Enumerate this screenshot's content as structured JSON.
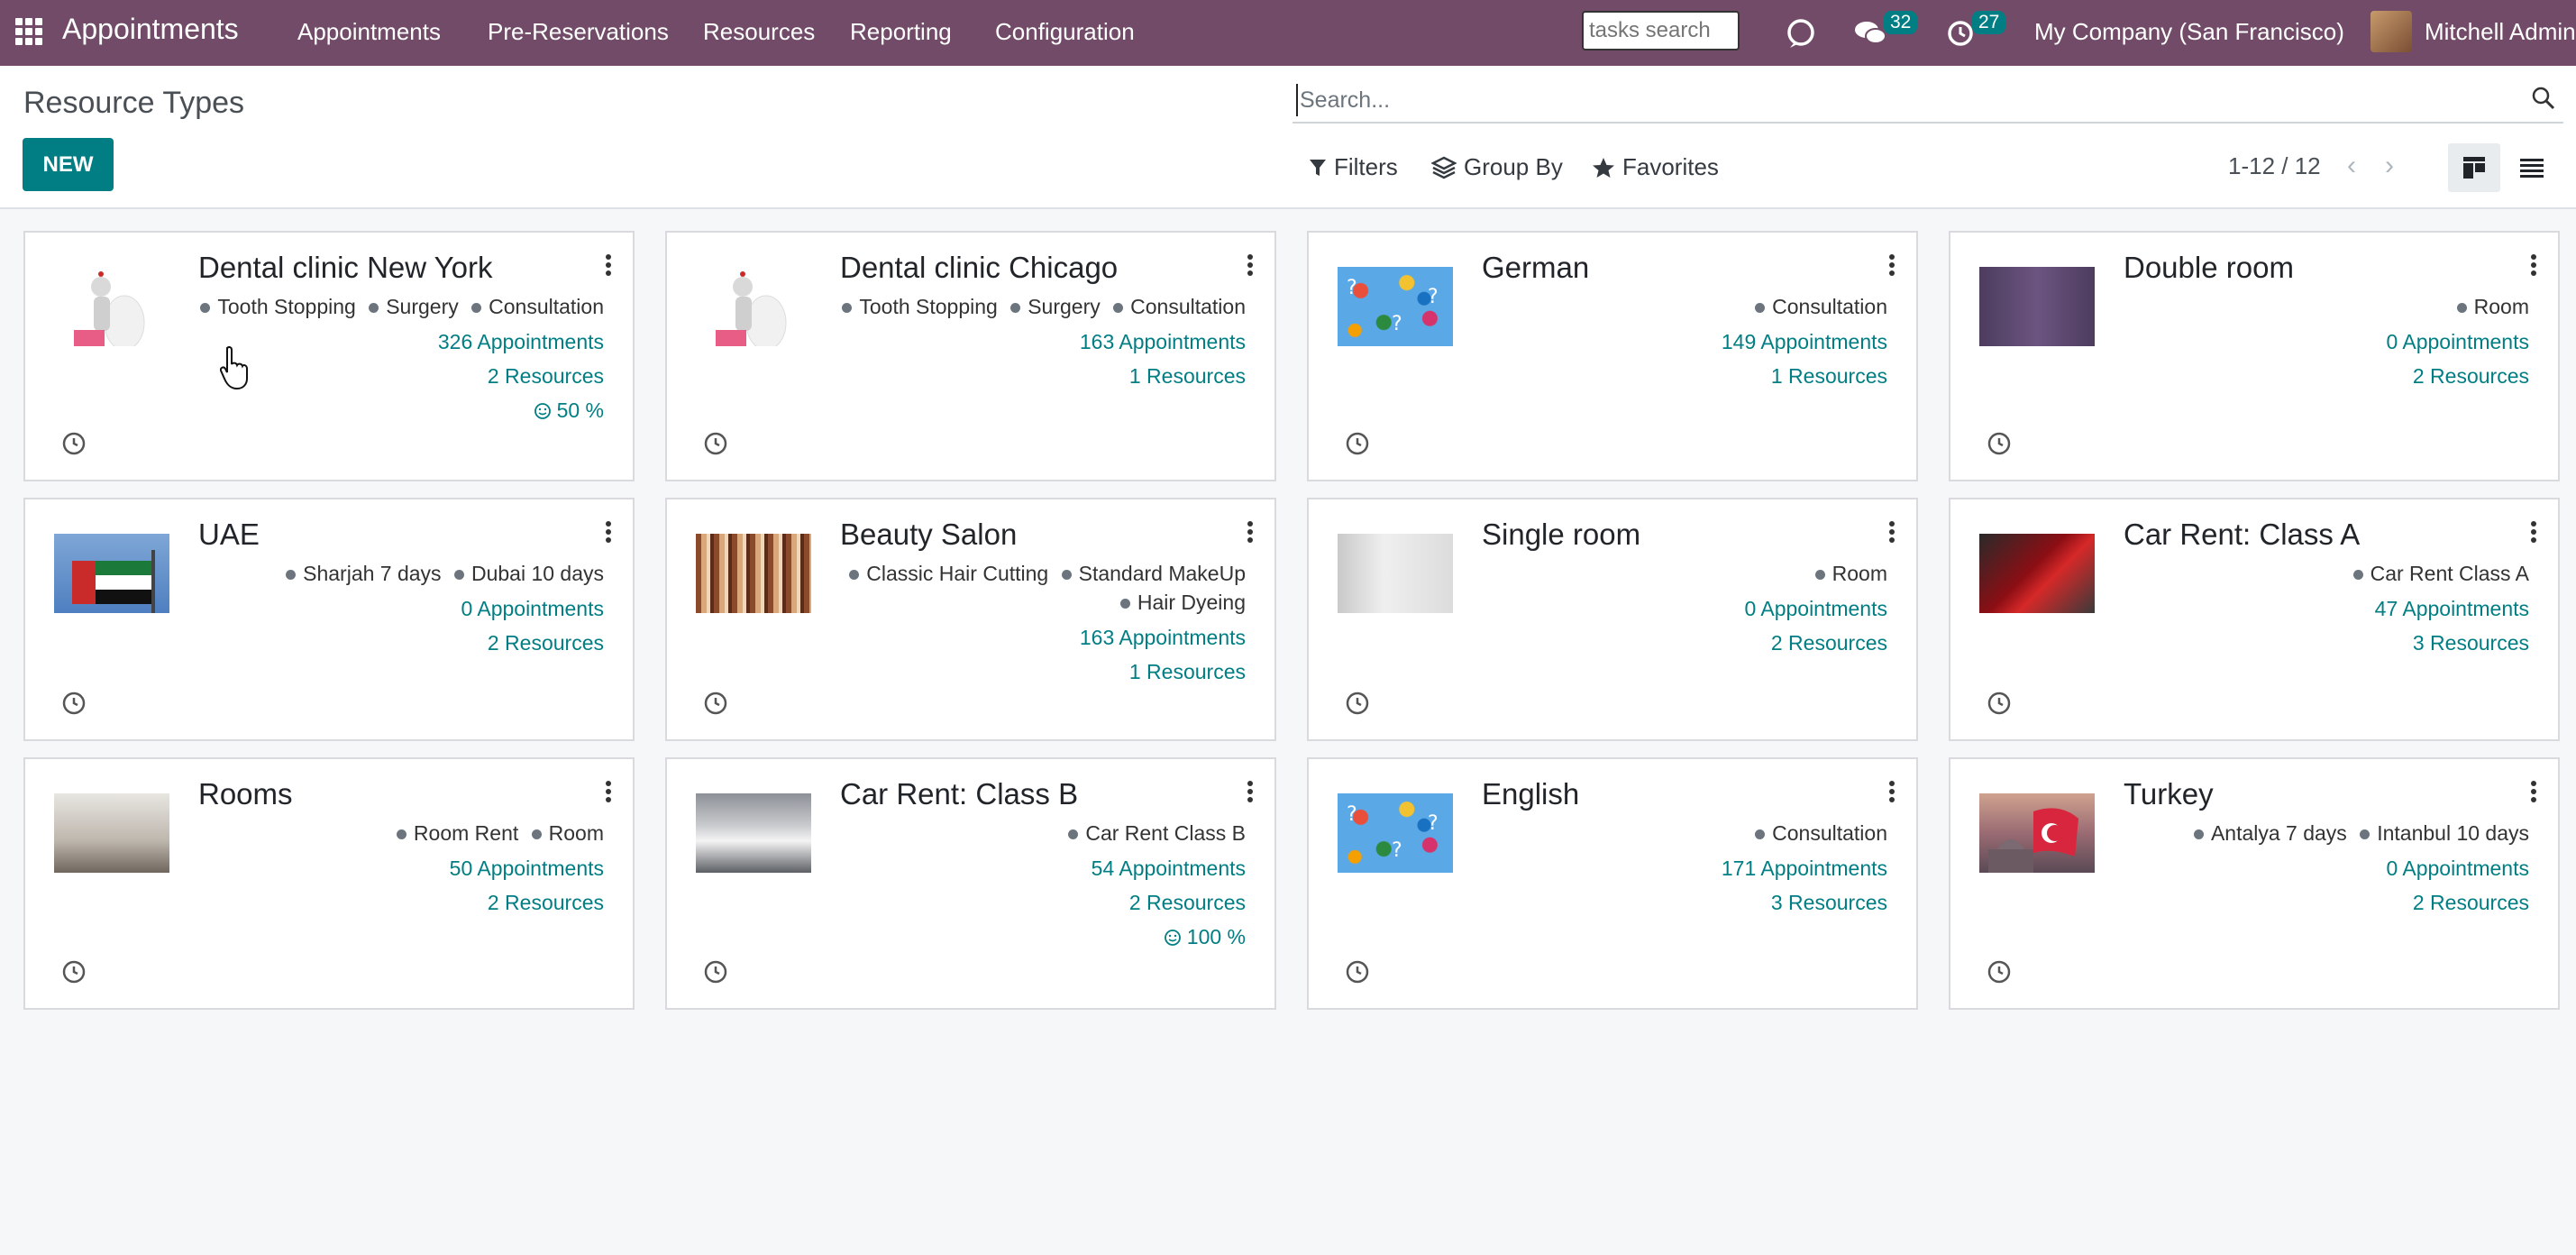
{
  "navbar": {
    "brand": "Appointments",
    "menu": [
      "Appointments",
      "Pre-Reservations",
      "Resources",
      "Reporting",
      "Configuration"
    ],
    "tasks_search_placeholder": "tasks search",
    "messages_badge": "32",
    "activities_badge": "27",
    "company": "My Company (San Francisco)",
    "user": "Mitchell Admin",
    "accent": "#714b67"
  },
  "control_panel": {
    "title": "Resource Types",
    "new_label": "NEW",
    "search_placeholder": "Search...",
    "filters_label": "Filters",
    "group_by_label": "Group By",
    "favorites_label": "Favorites",
    "pager": "1-12 / 12"
  },
  "cards": [
    {
      "title": "Dental clinic New York",
      "image": "dentist-image",
      "tags": [
        "Tooth Stopping",
        "Surgery",
        "Consultation"
      ],
      "appointments": "326 Appointments",
      "resources": "2 Resources",
      "rating": "50 %"
    },
    {
      "title": "Dental clinic Chicago",
      "image": "dentist-image",
      "tags": [
        "Tooth Stopping",
        "Surgery",
        "Consultation"
      ],
      "appointments": "163 Appointments",
      "resources": "1 Resources",
      "rating": null
    },
    {
      "title": "German",
      "image": "letter-tiles-image",
      "tags": [
        "Consultation"
      ],
      "appointments": "149 Appointments",
      "resources": "1 Resources",
      "rating": null
    },
    {
      "title": "Double room",
      "image": "purple-room-image",
      "tags": [
        "Room"
      ],
      "appointments": "0 Appointments",
      "resources": "2 Resources",
      "rating": null
    },
    {
      "title": "UAE",
      "image": "uae-flag-image",
      "tags": [
        "Sharjah 7 days",
        "Dubai 10 days"
      ],
      "appointments": "0 Appointments",
      "resources": "2 Resources",
      "rating": null
    },
    {
      "title": "Beauty Salon",
      "image": "hair-salon-image",
      "tags": [
        "Classic Hair Cutting",
        "Standard MakeUp",
        "Hair Dyeing"
      ],
      "appointments": "163 Appointments",
      "resources": "1 Resources",
      "rating": null
    },
    {
      "title": "Single room",
      "image": "single-room-image",
      "tags": [
        "Room"
      ],
      "appointments": "0 Appointments",
      "resources": "2 Resources",
      "rating": null
    },
    {
      "title": "Car Rent: Class A",
      "image": "red-car-image",
      "tags": [
        "Car Rent Class A"
      ],
      "appointments": "47 Appointments",
      "resources": "3 Resources",
      "rating": null
    },
    {
      "title": "Rooms",
      "image": "living-room-image",
      "tags": [
        "Room Rent",
        "Room"
      ],
      "appointments": "50 Appointments",
      "resources": "2 Resources",
      "rating": null
    },
    {
      "title": "Car Rent: Class B",
      "image": "white-suv-image",
      "tags": [
        "Car Rent Class B"
      ],
      "appointments": "54 Appointments",
      "resources": "2 Resources",
      "rating": "100 %"
    },
    {
      "title": "English",
      "image": "letter-tiles-image",
      "tags": [
        "Consultation"
      ],
      "appointments": "171 Appointments",
      "resources": "3 Resources",
      "rating": null
    },
    {
      "title": "Turkey",
      "image": "turkey-flag-image",
      "tags": [
        "Antalya 7 days",
        "Intanbul 10 days"
      ],
      "appointments": "0 Appointments",
      "resources": "2 Resources",
      "rating": null
    }
  ]
}
